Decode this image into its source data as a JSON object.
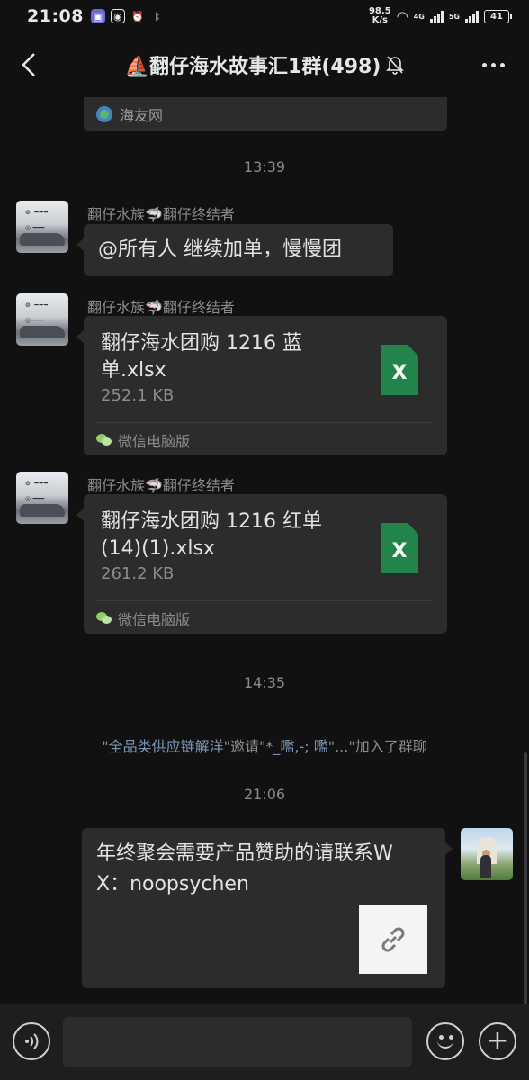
{
  "status_bar": {
    "time": "21:08",
    "net_speed_value": "98.5",
    "net_speed_unit": "K/s",
    "signal1_label": "4G",
    "signal2_label": "5G",
    "battery": "41"
  },
  "header": {
    "title": "⛵翻仔海水故事汇1群(498)"
  },
  "messages": {
    "link_card_source": "海友网",
    "time_1": "13:39",
    "msg1": {
      "sender": "翻仔水族🦈翻仔终结者",
      "text": "@所有人  继续加单，慢慢团"
    },
    "msg2": {
      "sender": "翻仔水族🦈翻仔终结者",
      "file_name": "翻仔海水团购 1216 蓝单.xlsx",
      "file_size": "252.1 KB",
      "file_icon_letter": "X",
      "source": "微信电脑版"
    },
    "msg3": {
      "sender": "翻仔水族🦈翻仔终结者",
      "file_name": "翻仔海水团购 1216 红单(14)(1).xlsx",
      "file_size": "261.2 KB",
      "file_icon_letter": "X",
      "source": "微信电脑版"
    },
    "time_2": "14:35",
    "system": {
      "name1": "\"全品类供应链解洋",
      "mid": "\"邀请\"",
      "name2": "*_嚂,-; 嚂",
      "end": "\"...\"加入了群聊"
    },
    "time_3": "21:06",
    "msg4": {
      "text": "年终聚会需要产品赞助的请联系WX：noopsychen"
    }
  },
  "input_bar": {
    "placeholder": ""
  }
}
